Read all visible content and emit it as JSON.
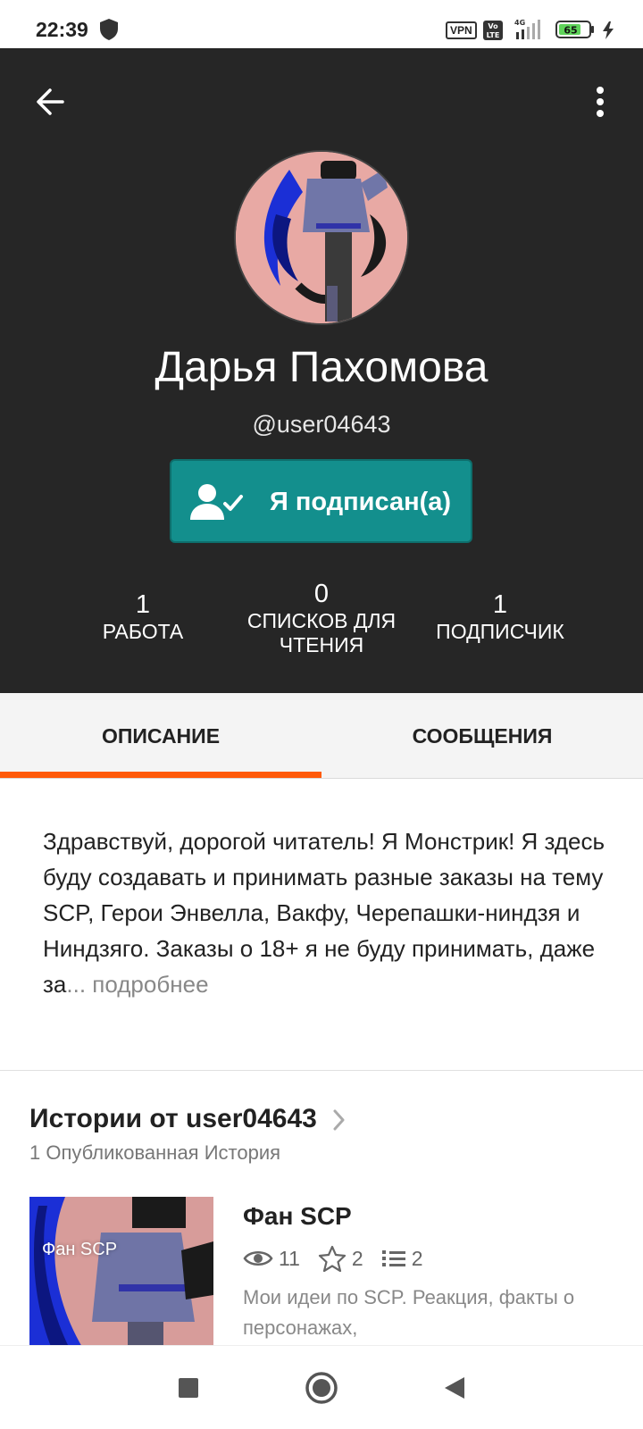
{
  "status_bar": {
    "time": "22:39",
    "vpn_label": "VPN",
    "volte_label": "Vo LTE",
    "network_label": "4G",
    "battery_level": "65",
    "icons": [
      "shield-icon",
      "signal-icon",
      "battery-icon",
      "charging-icon"
    ]
  },
  "profile": {
    "display_name": "Дарья Пахомова",
    "username": "@user04643",
    "follow_button_label": "Я подписан(а)",
    "stats": [
      {
        "value": "1",
        "label": "РАБОТА"
      },
      {
        "value": "0",
        "label": "СПИСКОВ ДЛЯ ЧТЕНИЯ"
      },
      {
        "value": "1",
        "label": "ПОДПИСЧИК"
      }
    ]
  },
  "tabs": [
    {
      "label": "ОПИСАНИЕ",
      "active": true
    },
    {
      "label": "СООБЩЕНИЯ",
      "active": false
    }
  ],
  "description": {
    "text": "Здравствуй, дорогой читатель! Я Монстрик! Я здесь буду создавать и принимать разные заказы на тему SCP, Герои Энвелла, Вакфу, Черепашки-ниндзя и Ниндзяго. Заказы о 18+ я не буду принимать, даже за",
    "ellipsis": "...",
    "more_label": "подробнее"
  },
  "stories": {
    "title": "Истории от user04643",
    "count_label": "1 Опубликованная История",
    "items": [
      {
        "cover_title": "Фан SCP",
        "title": "Фан SCP",
        "views": "11",
        "votes": "2",
        "parts": "2",
        "description": "Мои идеи по SCP. Реакция, факты о персонажах,"
      }
    ]
  },
  "colors": {
    "header_bg": "#262626",
    "follow_button": "#138f8d",
    "tab_indicator": "#ff5a0a"
  }
}
